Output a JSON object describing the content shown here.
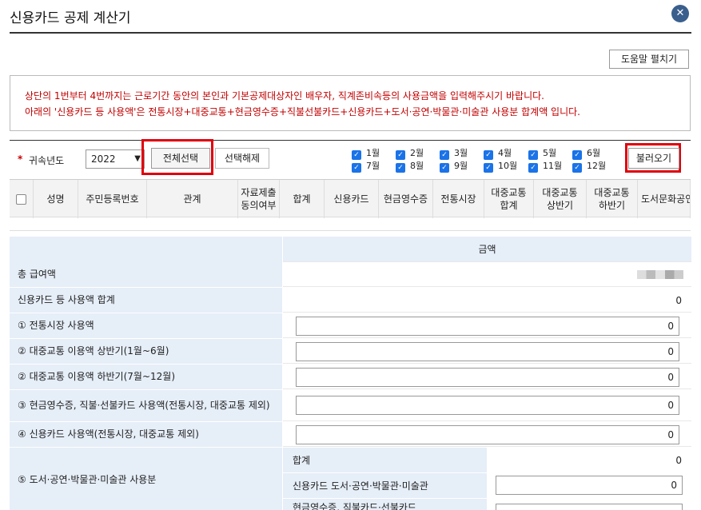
{
  "window": {
    "title": "신용카드 공제 계산기",
    "close_glyph": "✕"
  },
  "help_button": "도움말 펼치기",
  "notice": {
    "line1": "상단의 1번부터 4번까지는 근로기간 동안의 본인과 기본공제대상자인 배우자, 직계존비속등의 사용금액을 입력해주시기 바랍니다.",
    "line2": "아래의 '신용카드 등 사용액'은 전통시장+대중교통+현금영수증+직불선불카드+신용카드+도서·공연·박물관·미술관 사용분 합계액 입니다."
  },
  "toolbar": {
    "required_mark": "*",
    "year_label": "귀속년도",
    "year_value": "2022",
    "select_all": "전체선택",
    "deselect_all": "선택해제",
    "months": [
      "1월",
      "2월",
      "3월",
      "4월",
      "5월",
      "6월",
      "7월",
      "8월",
      "9월",
      "10월",
      "11월",
      "12월"
    ],
    "load": "불러오기"
  },
  "grid": {
    "columns": [
      "성명",
      "주민등록번호",
      "관계",
      "자료제출 동의여부",
      "합계",
      "신용카드",
      "현금영수증",
      "전통시장",
      "대중교통 합계",
      "대중교통 상반기",
      "대중교통 하반기",
      "도서문화공연"
    ]
  },
  "amount": {
    "header": "금액",
    "rows": [
      {
        "label": "총 급여액",
        "value": ""
      },
      {
        "label": "신용카드 등 사용액 합계",
        "value": "0"
      },
      {
        "label": "① 전통시장 사용액",
        "input": "0"
      },
      {
        "label": "② 대중교통 이용액 상반기(1월~6월)",
        "input": "0"
      },
      {
        "label": "② 대중교통 이용액 하반기(7월~12월)",
        "input": "0"
      },
      {
        "label": "③ 현금영수증, 직불·선불카드 사용액(전통시장, 대중교통 제외)",
        "input": "0"
      },
      {
        "label": "④ 신용카드 사용액(전통시장, 대중교통 제외)",
        "input": "0"
      }
    ],
    "culture": {
      "label": "⑤ 도서·공연·박물관·미술관 사용분",
      "sum_label": "합계",
      "sum_value": "0",
      "credit_label": "신용카드 도서·공연·박물관·미술관",
      "credit_value": "0",
      "cash_label": "현금영수증, 직불카드·선불카드"
    }
  }
}
